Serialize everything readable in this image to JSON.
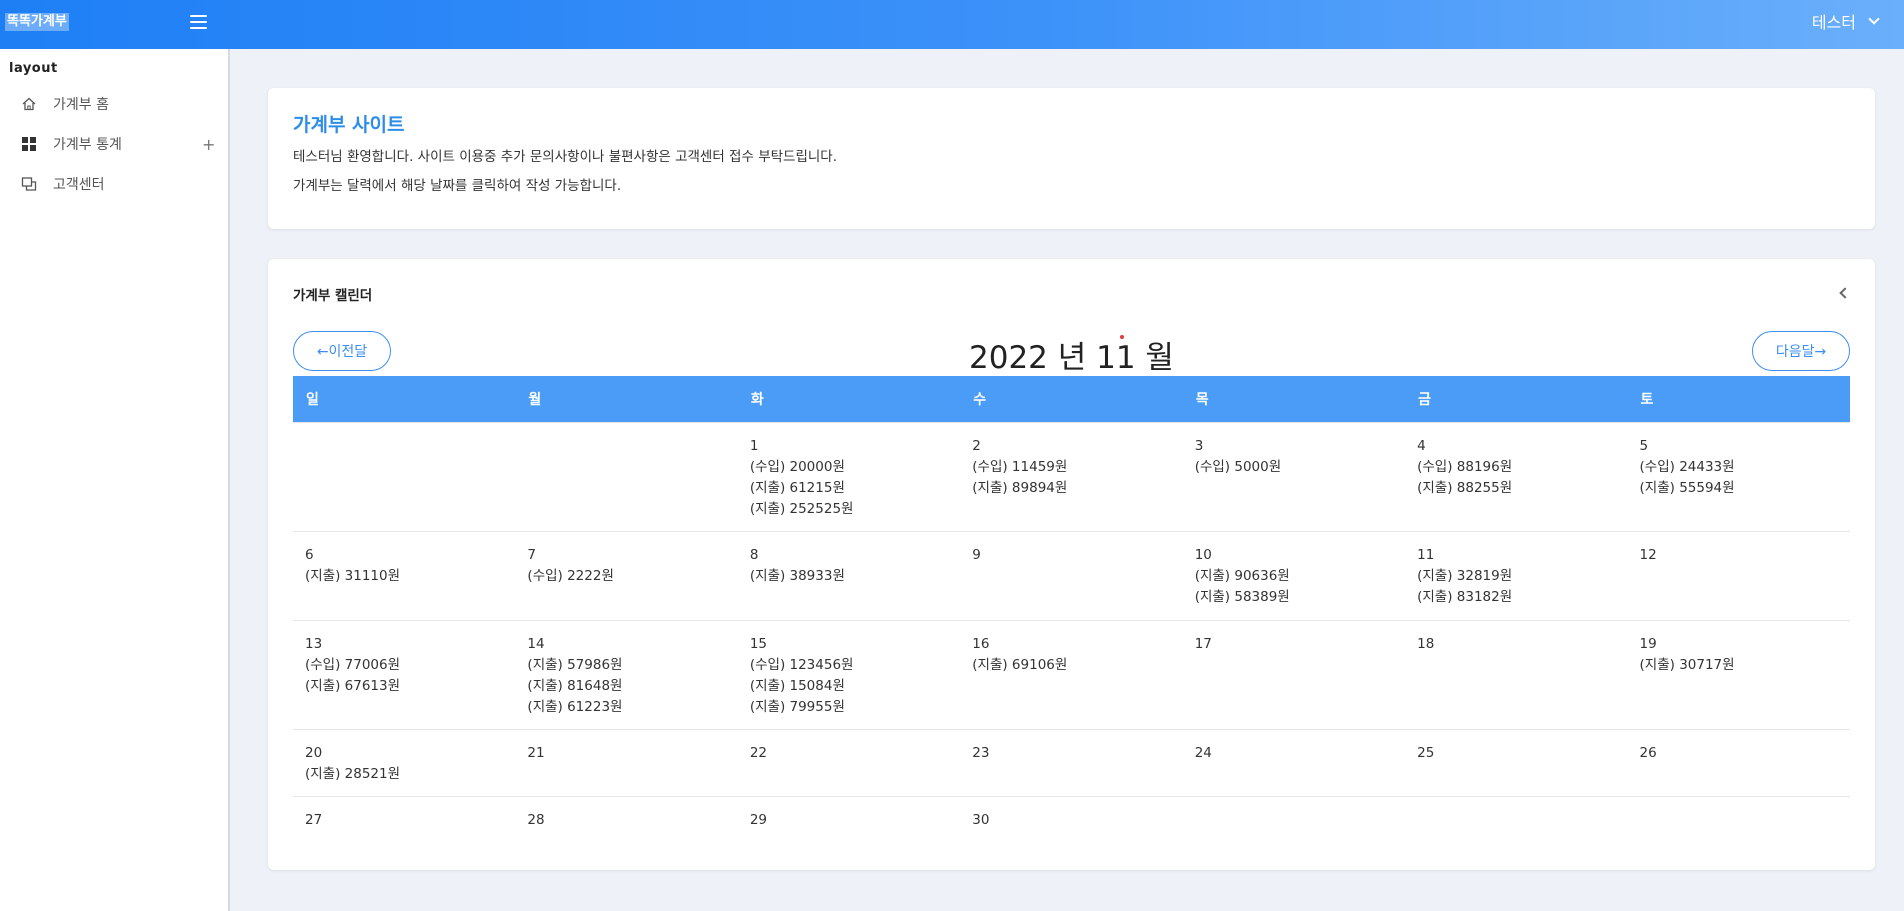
{
  "header": {
    "brand": "똑똑가계부",
    "user": "테스터"
  },
  "sidebar": {
    "section": "layout",
    "items": [
      {
        "label": "가계부 홈",
        "icon": "home-icon"
      },
      {
        "label": "가계부 통계",
        "icon": "grid-icon",
        "expand": "+"
      },
      {
        "label": "고객센터",
        "icon": "copy-icon"
      }
    ]
  },
  "welcome": {
    "title": "가계부 사이트",
    "line1": "테스터님 환영합니다. 사이트 이용중 추가 문의사항이나 불편사항은 고객센터 접수 부탁드립니다.",
    "line2": "가계부는 달력에서 해당 날짜를 클릭하여 작성 가능합니다."
  },
  "calendar": {
    "title": "가계부 캘린더",
    "prev_label": "←이전달",
    "next_label": "다음달→",
    "month_title": "2022 년 11 월",
    "weekdays": [
      "일",
      "월",
      "화",
      "수",
      "목",
      "금",
      "토"
    ],
    "weeks": [
      [
        {
          "day": "",
          "entries": []
        },
        {
          "day": "",
          "entries": []
        },
        {
          "day": "1",
          "entries": [
            "(수입) 20000원",
            "(지출) 61215원",
            "(지출) 252525원"
          ]
        },
        {
          "day": "2",
          "entries": [
            "(수입) 11459원",
            "(지출) 89894원"
          ]
        },
        {
          "day": "3",
          "entries": [
            "(수입) 5000원"
          ]
        },
        {
          "day": "4",
          "entries": [
            "(수입) 88196원",
            "(지출) 88255원"
          ]
        },
        {
          "day": "5",
          "entries": [
            "(수입) 24433원",
            "(지출) 55594원"
          ]
        }
      ],
      [
        {
          "day": "6",
          "entries": [
            "(지출) 31110원"
          ]
        },
        {
          "day": "7",
          "entries": [
            "(수입) 2222원"
          ]
        },
        {
          "day": "8",
          "entries": [
            "(지출) 38933원"
          ]
        },
        {
          "day": "9",
          "entries": []
        },
        {
          "day": "10",
          "entries": [
            "(지출) 90636원",
            "(지출) 58389원"
          ]
        },
        {
          "day": "11",
          "entries": [
            "(지출) 32819원",
            "(지출) 83182원"
          ]
        },
        {
          "day": "12",
          "entries": []
        }
      ],
      [
        {
          "day": "13",
          "entries": [
            "(수입) 77006원",
            "(지출) 67613원"
          ]
        },
        {
          "day": "14",
          "entries": [
            "(지출) 57986원",
            "(지출) 81648원",
            "(지출) 61223원"
          ]
        },
        {
          "day": "15",
          "entries": [
            "(수입) 123456원",
            "(지출) 15084원",
            "(지출) 79955원"
          ]
        },
        {
          "day": "16",
          "entries": [
            "(지출) 69106원"
          ]
        },
        {
          "day": "17",
          "entries": []
        },
        {
          "day": "18",
          "entries": []
        },
        {
          "day": "19",
          "entries": [
            "(지출) 30717원"
          ]
        }
      ],
      [
        {
          "day": "20",
          "entries": [
            "(지출) 28521원"
          ]
        },
        {
          "day": "21",
          "entries": []
        },
        {
          "day": "22",
          "entries": []
        },
        {
          "day": "23",
          "entries": []
        },
        {
          "day": "24",
          "entries": []
        },
        {
          "day": "25",
          "entries": []
        },
        {
          "day": "26",
          "entries": []
        }
      ],
      [
        {
          "day": "27",
          "entries": []
        },
        {
          "day": "28",
          "entries": []
        },
        {
          "day": "29",
          "entries": []
        },
        {
          "day": "30",
          "entries": []
        },
        {
          "day": "",
          "entries": []
        },
        {
          "day": "",
          "entries": []
        },
        {
          "day": "",
          "entries": []
        }
      ]
    ]
  },
  "colors": {
    "accent": "#3d8ef0",
    "header_row": "#4a9cf6",
    "title": "#2e8de8"
  }
}
